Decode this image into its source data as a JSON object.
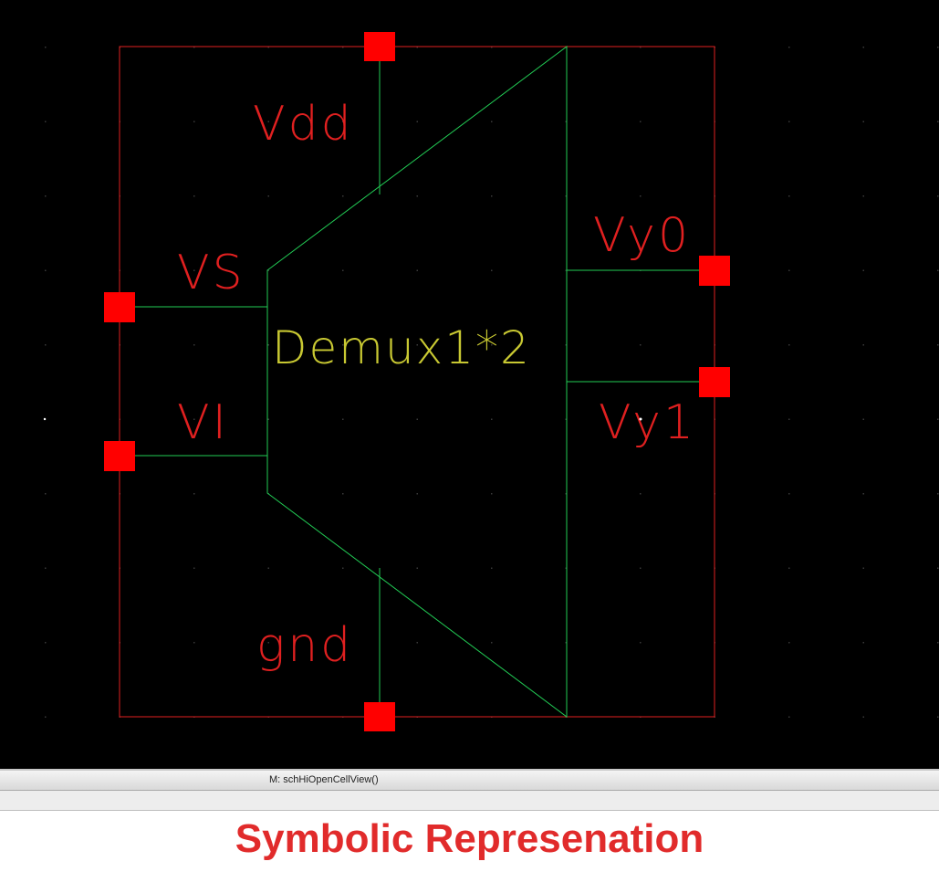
{
  "schematic": {
    "cell_name": "Demux1*2",
    "pins": {
      "vdd": "Vdd",
      "vs": "VS",
      "vi": "VI",
      "vy0": "Vy0",
      "vy1": "Vy1",
      "gnd": "gnd"
    },
    "colors": {
      "background": "#000000",
      "boundary": "#e02020",
      "pin_square": "#ff0000",
      "wire": "#22cc55",
      "pin_label": "#e02020",
      "cell_label": "#c8c832",
      "grid_dot": "#3a3a3a"
    }
  },
  "statusbar": {
    "mouse_text": "M: schHiOpenCellView()"
  },
  "caption": {
    "text": "Symbolic Represenation"
  }
}
